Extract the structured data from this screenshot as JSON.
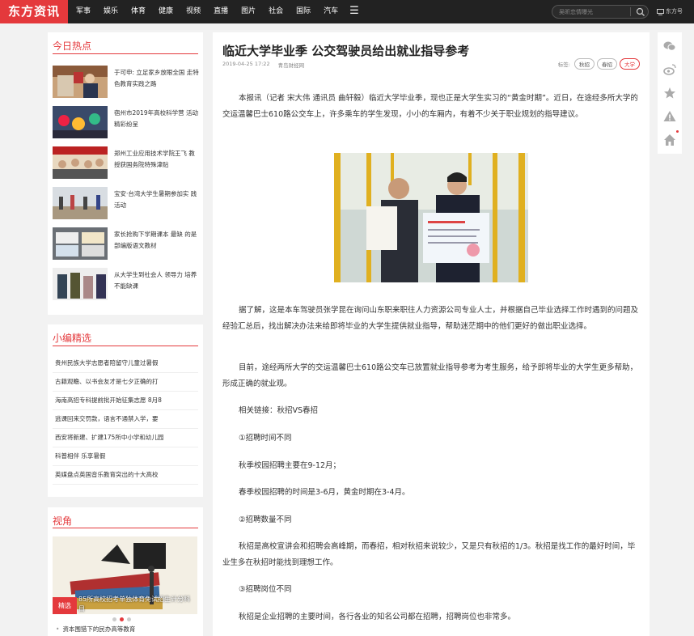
{
  "nav": {
    "logo": "东方资讯",
    "items": [
      "军事",
      "娱乐",
      "体育",
      "健康",
      "视频",
      "直播",
      "图片",
      "社会",
      "国际",
      "汽车"
    ],
    "menu_icon": "menu-icon",
    "search_placeholder": "吴昕恋情曝光",
    "site_link": "东方号"
  },
  "hot": {
    "title": "今日热点",
    "items": [
      {
        "text": "于可申: 立足家乡放眼全国 走特色教育实践之路"
      },
      {
        "text": "宿州市2019年高校科学营 活动精彩纷呈"
      },
      {
        "text": "郑州工业应用技术学院王飞 教授获国务院特殊津贴"
      },
      {
        "text": "宝安·台湾大学生暑期参加实 践活动"
      },
      {
        "text": "家长抢购下学期课本 最缺 的是部编版语文教材"
      },
      {
        "text": "从大学生到社会人 领导力 培养不能缺课"
      }
    ]
  },
  "picks": {
    "title": "小编精选",
    "items": [
      "贵州民族大学志愿者陪留守儿童过暑假",
      "古籍观瞻、以书会友才是七夕正确的打",
      "海南高招专科提前批开始征集志愿 8月8",
      "逃课回来交罚款，语言不通禁入学，要",
      "西安将新建、扩建175所中小学和幼儿园",
      "科普相伴 乐享暑假",
      "英媒盘点英国音乐教育突出的十大高校"
    ]
  },
  "views": {
    "title": "视角",
    "badge": "精选",
    "caption": "85所高校招考单独体育免试招生计分科目",
    "list_item": "资本围猎下的民办高等教育"
  },
  "article": {
    "title": "临近大学毕业季 公交驾驶员给出就业指导参考",
    "date": "2019-04-25 17:22",
    "source": "青岛财经网",
    "tags_label": "标签:",
    "tags": [
      "秋招",
      "春招",
      "大学"
    ],
    "paragraphs": [
      "本报讯（记者 宋大伟 通讯员 曲轩毅）临近大学毕业季，现也正是大学生实习的“黄金时期”。近日，在途经多所大学的交运温馨巴士610路公交车上，许多乘车的学生发现，小小的车厢内，有着不少关于职业规划的指导建议。",
      "据了解，这是本车驾驶员张学昆在询问山东职来职往人力资源公司专业人士，并根据自己毕业选择工作时遇到的问题及经验汇总后，找出解决办法来给即将毕业的大学生提供就业指导，帮助迷茫期中的他们更好的做出职业选择。",
      "目前，途经两所大学的交运温馨巴士610路公交车已放置就业指导参考为考生服务，给予即将毕业的大学生更多帮助，形成正确的就业观。",
      "相关链接：秋招VS春招",
      "①招聘时间不同",
      "秋季校园招聘主要在9-12月；",
      "春季校园招聘的时间是3-6月，黄金时期在3-4月。",
      "②招聘数量不同",
      "秋招是高校宣讲会和招聘会高峰期，而春招，相对秋招来说较少，又是只有秋招的1/3。秋招是找工作的最好时间，毕业生多在秋招时能找到理想工作。",
      "③招聘岗位不同",
      "秋招是企业招聘的主要时间，各行各业的知名公司都在招聘，招聘岗位也非常多。"
    ]
  },
  "tools": [
    "wechat-icon",
    "weibo-icon",
    "star-icon",
    "warning-icon",
    "home-icon"
  ],
  "colors": {
    "accent": "#e4393c",
    "topbar": "#222222"
  }
}
